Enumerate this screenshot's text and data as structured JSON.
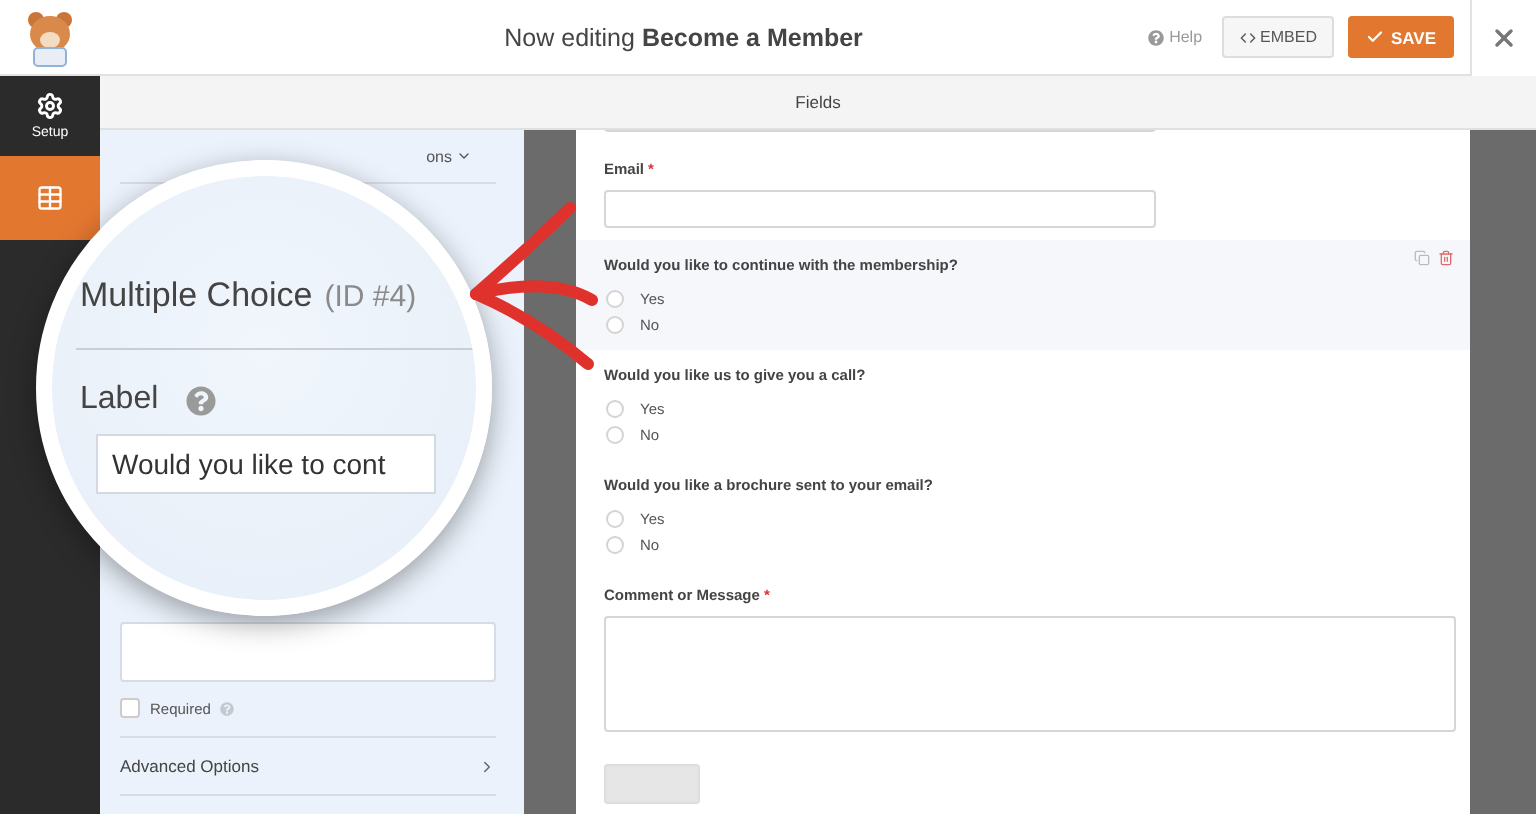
{
  "header": {
    "title_prefix": "Now editing",
    "form_name": "Become a Member",
    "help": "Help",
    "embed": "EMBED",
    "save": "SAVE"
  },
  "section_title": "Fields",
  "sidebar": [
    {
      "kind": "setup",
      "label": "Setup",
      "selected": false
    },
    {
      "kind": "fields",
      "selected": true
    }
  ],
  "panel": {
    "tab_fragment": "ons",
    "required": {
      "label": "Required",
      "checked": false
    },
    "sections": [
      "Advanced Options"
    ]
  },
  "magnifier": {
    "field_type": "Multiple Choice",
    "field_id": "(ID #4)",
    "label_heading": "Label",
    "label_value": "Would you like to cont"
  },
  "form": {
    "fields": [
      {
        "kind": "text"
      },
      {
        "kind": "text",
        "label": "Email",
        "required_mark": "*"
      },
      {
        "kind": "radio",
        "label": "Would you like to continue with the membership?",
        "selected": true,
        "options": [
          {
            "label": "Yes",
            "selected": false
          },
          {
            "label": "No",
            "selected": false
          }
        ]
      },
      {
        "kind": "radio",
        "label": "Would you like us to give you a call?",
        "selected": false,
        "options": [
          {
            "label": "Yes",
            "selected": false
          },
          {
            "label": "No",
            "selected": false
          }
        ]
      },
      {
        "kind": "radio",
        "label": "Would you like a brochure sent to your email?",
        "selected": false,
        "options": [
          {
            "label": "Yes",
            "selected": false
          },
          {
            "label": "No",
            "selected": false
          }
        ]
      },
      {
        "kind": "textarea",
        "label": "Comment or Message",
        "required_mark": "*"
      }
    ]
  }
}
